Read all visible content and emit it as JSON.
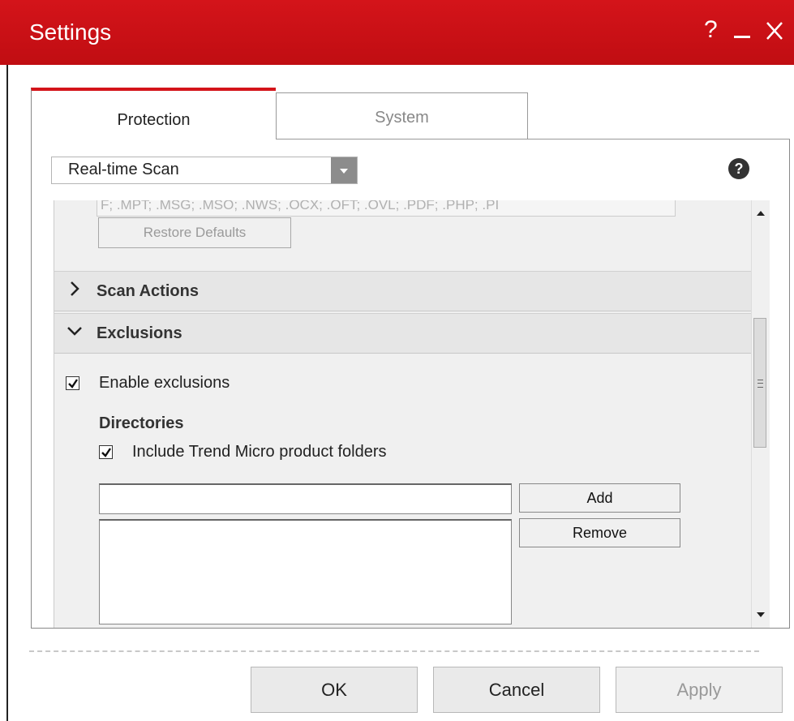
{
  "window": {
    "title": "Settings",
    "help": "?",
    "minimize": "—",
    "close": "✕"
  },
  "tabs": [
    {
      "label": "Protection",
      "active": true
    },
    {
      "label": "System",
      "active": false
    }
  ],
  "category_select": {
    "value": "Real-time Scan"
  },
  "panel_help": "?",
  "file_extensions": {
    "value": "F; .MPT; .MSG; .MSO; .NWS; .OCX; .OFT; .OVL; .PDF; .PHP; .PI"
  },
  "restore_defaults": "Restore Defaults",
  "sections": [
    {
      "label": "Scan Actions",
      "expanded": false
    },
    {
      "label": "Exclusions",
      "expanded": true
    }
  ],
  "exclusions": {
    "enable_label": "Enable exclusions",
    "enable_checked": true,
    "directories_title": "Directories",
    "include_tm_label": "Include Trend Micro product folders",
    "include_tm_checked": true,
    "directory_input": {
      "value": ""
    },
    "add_label": "Add",
    "remove_label": "Remove"
  },
  "footer": {
    "ok": "OK",
    "cancel": "Cancel",
    "apply": "Apply"
  },
  "colors": {
    "brand_red": "#d4141a",
    "disabled_text": "#999999"
  }
}
